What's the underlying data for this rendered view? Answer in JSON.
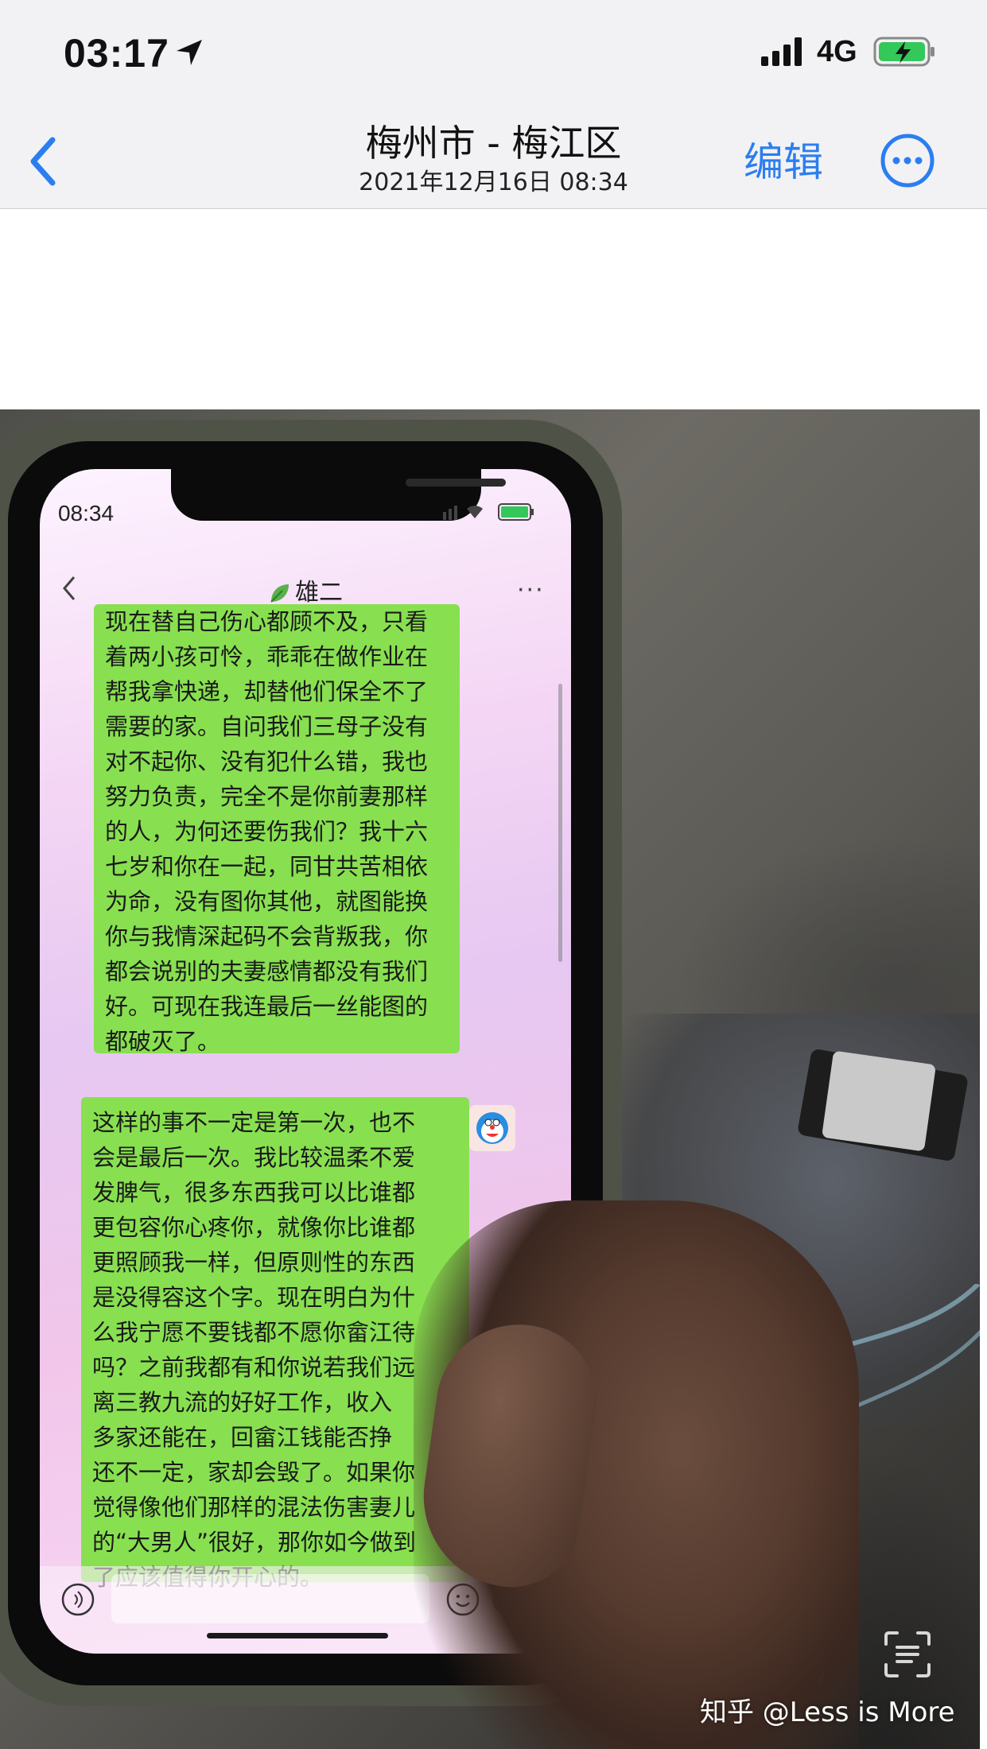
{
  "status_bar": {
    "time": "03:17",
    "network": "4G"
  },
  "nav": {
    "title": "梅州市 - 梅江区",
    "subtitle": "2021年12月16日  08:34",
    "edit_label": "编辑"
  },
  "photo": {
    "phone": {
      "time": "08:34",
      "chat_title": "雄二",
      "more_label": "···",
      "bubble1_lines": [
        "现在替自己伤心都顾不及，只看",
        "着两小孩可怜，乖乖在做作业在",
        "帮我拿快递，却替他们保全不了",
        "需要的家。自问我们三母子没有",
        "对不起你、没有犯什么错，我也",
        "努力负责，完全不是你前妻那样",
        "的人，为何还要伤我们？我十六",
        "七岁和你在一起，同甘共苦相依",
        "为命，没有图你其他，就图能换",
        "你与我情深起码不会背叛我，你",
        "都会说别的夫妻感情都没有我们",
        "好。可现在我连最后一丝能图的",
        "都破灭了。"
      ],
      "bubble2_lines": [
        "这样的事不一定是第一次，也不",
        "会是最后一次。我比较温柔不爱",
        "发脾气，很多东西我可以比谁都",
        "更包容你心疼你，就像你比谁都",
        "更照顾我一样，但原则性的东西",
        "是没得容这个字。现在明白为什",
        "么我宁愿不要钱都不愿你畲江待",
        "吗？之前我都有和你说若我们远",
        "离三教九流的好好工作，收入",
        "多家还能在，回畲江钱能否挣",
        "还不一定，家却会毁了。如果你",
        "觉得像他们那样的混法伤害妻儿",
        "的“大男人”很好，那你如今做到",
        "了应该值得你开心的。"
      ]
    },
    "watermark": "知乎 @Less is More"
  },
  "colors": {
    "accent": "#2b7ef0",
    "bubble": "#88e050"
  }
}
